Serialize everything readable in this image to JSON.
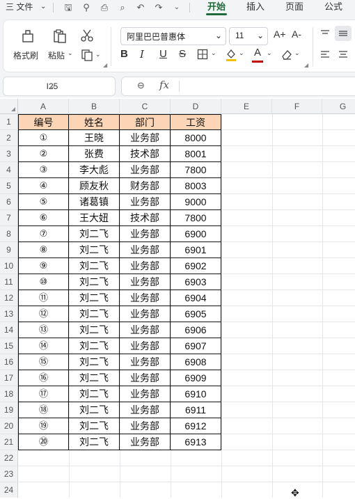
{
  "menu": {
    "app_menu_label": "三 文件",
    "tabs": [
      {
        "label": "开始",
        "active": true
      },
      {
        "label": "插入",
        "active": false
      },
      {
        "label": "页面",
        "active": false
      },
      {
        "label": "公式",
        "active": false
      }
    ]
  },
  "ribbon": {
    "format_painter_label": "格式刷",
    "paste_label": "粘贴",
    "font_name": "阿里巴巴普惠体",
    "font_size": "11",
    "bold": "B",
    "italic": "I",
    "underline": "U",
    "strike": "S",
    "font_color_letter": "A",
    "font_color": "#c00000",
    "grow_font": "A+",
    "shrink_font": "A-"
  },
  "formula_bar": {
    "name_box": "I25",
    "fx_label": "fx",
    "formula": ""
  },
  "sheet": {
    "column_headers": [
      "A",
      "B",
      "C",
      "D",
      "E",
      "F",
      "G"
    ],
    "row_numbers": [
      "1",
      "2",
      "3",
      "4",
      "5",
      "6",
      "7",
      "8",
      "9",
      "10",
      "11",
      "12",
      "13",
      "14",
      "15",
      "16",
      "17",
      "18",
      "19",
      "20",
      "21",
      "22",
      "23",
      "24"
    ],
    "header_fill": "#fbd5b5",
    "table_headers": [
      "编号",
      "姓名",
      "部门",
      "工资"
    ],
    "rows": [
      [
        "①",
        "王晓",
        "业务部",
        "8000"
      ],
      [
        "②",
        "张费",
        "技术部",
        "8001"
      ],
      [
        "③",
        "李大彪",
        "业务部",
        "7800"
      ],
      [
        "④",
        "顾友秋",
        "财务部",
        "8003"
      ],
      [
        "⑤",
        "诸葛镇",
        "业务部",
        "9000"
      ],
      [
        "⑥",
        "王大妞",
        "技术部",
        "7800"
      ],
      [
        "⑦",
        "刘二飞",
        "业务部",
        "6900"
      ],
      [
        "⑧",
        "刘二飞",
        "业务部",
        "6901"
      ],
      [
        "⑨",
        "刘二飞",
        "业务部",
        "6902"
      ],
      [
        "⑩",
        "刘二飞",
        "业务部",
        "6903"
      ],
      [
        "⑪",
        "刘二飞",
        "业务部",
        "6904"
      ],
      [
        "⑫",
        "刘二飞",
        "业务部",
        "6905"
      ],
      [
        "⑬",
        "刘二飞",
        "业务部",
        "6906"
      ],
      [
        "⑭",
        "刘二飞",
        "业务部",
        "6907"
      ],
      [
        "⑮",
        "刘二飞",
        "业务部",
        "6908"
      ],
      [
        "⑯",
        "刘二飞",
        "业务部",
        "6909"
      ],
      [
        "⑰",
        "刘二飞",
        "业务部",
        "6910"
      ],
      [
        "⑱",
        "刘二飞",
        "业务部",
        "6911"
      ],
      [
        "⑲",
        "刘二飞",
        "业务部",
        "6912"
      ],
      [
        "⑳",
        "刘二飞",
        "业务部",
        "6913"
      ]
    ]
  },
  "colors": {
    "accent": "#1f6b3b"
  }
}
